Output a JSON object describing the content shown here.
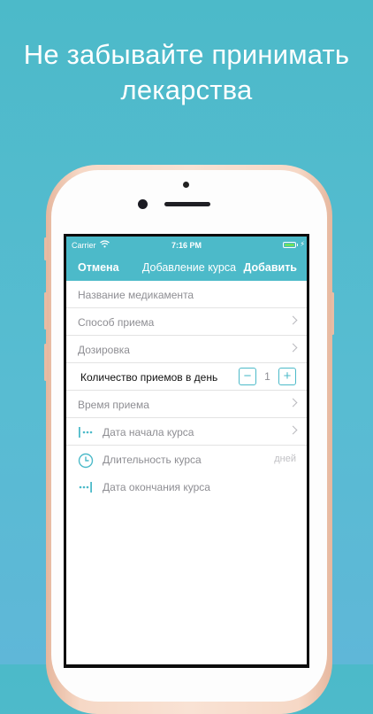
{
  "headline": {
    "line1": "Не забывайте принимать",
    "line2": "лекарства"
  },
  "status_bar": {
    "carrier": "Carrier",
    "time": "7:16 PM"
  },
  "navbar": {
    "cancel": "Отмена",
    "title": "Добавление курса",
    "add": "Добавить"
  },
  "form": {
    "medication_name_placeholder": "Название медикамента",
    "method": "Способ приема",
    "dosage": "Дозировка",
    "doses_per_day": {
      "label": "Количество приемов в день",
      "value": "1",
      "minus": "−",
      "plus": "+"
    },
    "intake_time": "Время приема",
    "start_date": "Дата начала курса",
    "duration": {
      "label": "Длительность курса",
      "unit": "дней"
    },
    "end_date": "Дата окончания курса"
  },
  "colors": {
    "accent": "#4cbac9",
    "background": "#55bcd0",
    "phone_body": "#f6d8c6"
  },
  "icons": [
    "wifi-icon",
    "battery-icon",
    "chevron-right-icon",
    "start-date-icon",
    "clock-icon",
    "end-date-icon"
  ]
}
